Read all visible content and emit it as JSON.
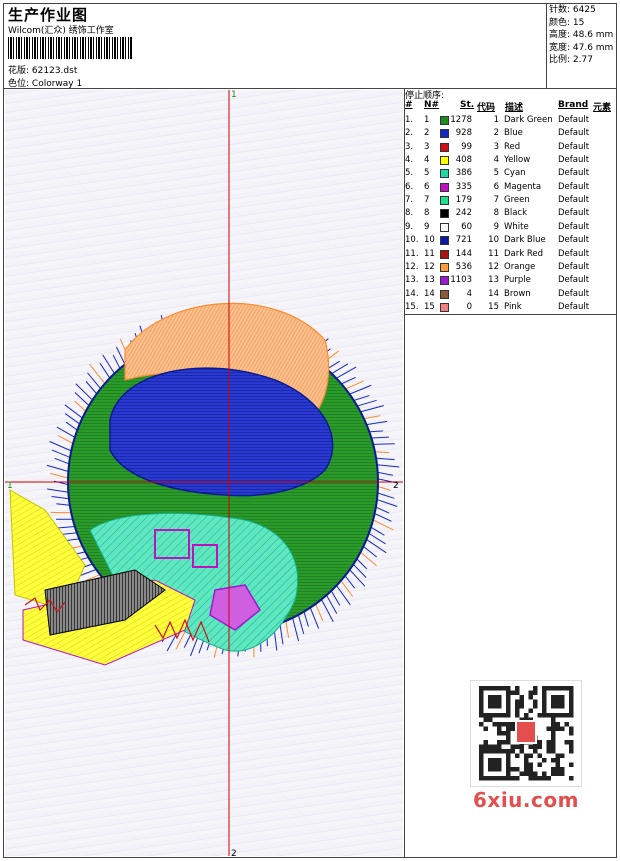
{
  "header": {
    "title": "生产作业图",
    "subtitle": "Wilcom(汇众) 绣饰工作室",
    "design_label": "花版:",
    "design_value": "62123.dst",
    "colorway_label": "色位:",
    "colorway_value": "Colorway 1"
  },
  "stats": {
    "stitches": "针数: 6425",
    "colors": "颜色: 15",
    "height": "高度: 48.6 mm",
    "width": "宽度: 47.6 mm",
    "scale": "比例: 2.77"
  },
  "axis_labels": {
    "top": "1",
    "bottom": "2",
    "left": "1",
    "right": "2"
  },
  "table": {
    "heading": "停止顺序:",
    "columns": [
      "#",
      "N#",
      "St.",
      "代码",
      "描述",
      "Brand",
      "元素"
    ],
    "rows": [
      {
        "idx": "1.",
        "n": "1",
        "st": "1278",
        "code": "1",
        "desc": "Dark Green",
        "brand": "Default",
        "color": "#1a8c1a"
      },
      {
        "idx": "2.",
        "n": "2",
        "st": "928",
        "code": "2",
        "desc": "Blue",
        "brand": "Default",
        "color": "#1428c8"
      },
      {
        "idx": "3.",
        "n": "3",
        "st": "99",
        "code": "3",
        "desc": "Red",
        "brand": "Default",
        "color": "#d01010"
      },
      {
        "idx": "4.",
        "n": "4",
        "st": "408",
        "code": "4",
        "desc": "Yellow",
        "brand": "Default",
        "color": "#ffff00"
      },
      {
        "idx": "5.",
        "n": "5",
        "st": "386",
        "code": "5",
        "desc": "Cyan",
        "brand": "Default",
        "color": "#22d8a8"
      },
      {
        "idx": "6.",
        "n": "6",
        "st": "335",
        "code": "6",
        "desc": "Magenta",
        "brand": "Default",
        "color": "#c010c0"
      },
      {
        "idx": "7.",
        "n": "7",
        "st": "179",
        "code": "7",
        "desc": "Green",
        "brand": "Default",
        "color": "#20e090"
      },
      {
        "idx": "8.",
        "n": "8",
        "st": "242",
        "code": "8",
        "desc": "Black",
        "brand": "Default",
        "color": "#000000"
      },
      {
        "idx": "9.",
        "n": "9",
        "st": "60",
        "code": "9",
        "desc": "White",
        "brand": "Default",
        "color": "#ffffff"
      },
      {
        "idx": "10.",
        "n": "10",
        "st": "721",
        "code": "10",
        "desc": "Dark Blue",
        "brand": "Default",
        "color": "#0a1aa0"
      },
      {
        "idx": "11.",
        "n": "11",
        "st": "144",
        "code": "11",
        "desc": "Dark Red",
        "brand": "Default",
        "color": "#b01010"
      },
      {
        "idx": "12.",
        "n": "12",
        "st": "536",
        "code": "12",
        "desc": "Orange",
        "brand": "Default",
        "color": "#ff9a3a"
      },
      {
        "idx": "13.",
        "n": "13",
        "st": "1103",
        "code": "13",
        "desc": "Purple",
        "brand": "Default",
        "color": "#9a1ad0"
      },
      {
        "idx": "14.",
        "n": "14",
        "st": "4",
        "code": "14",
        "desc": "Brown",
        "brand": "Default",
        "color": "#8a5a3a"
      },
      {
        "idx": "15.",
        "n": "15",
        "st": "0",
        "code": "15",
        "desc": "Pink",
        "brand": "Default",
        "color": "#f08080"
      }
    ]
  },
  "watermark": "6xiu.com",
  "colors": {
    "axis": "#d00000",
    "frame": "#444444"
  }
}
